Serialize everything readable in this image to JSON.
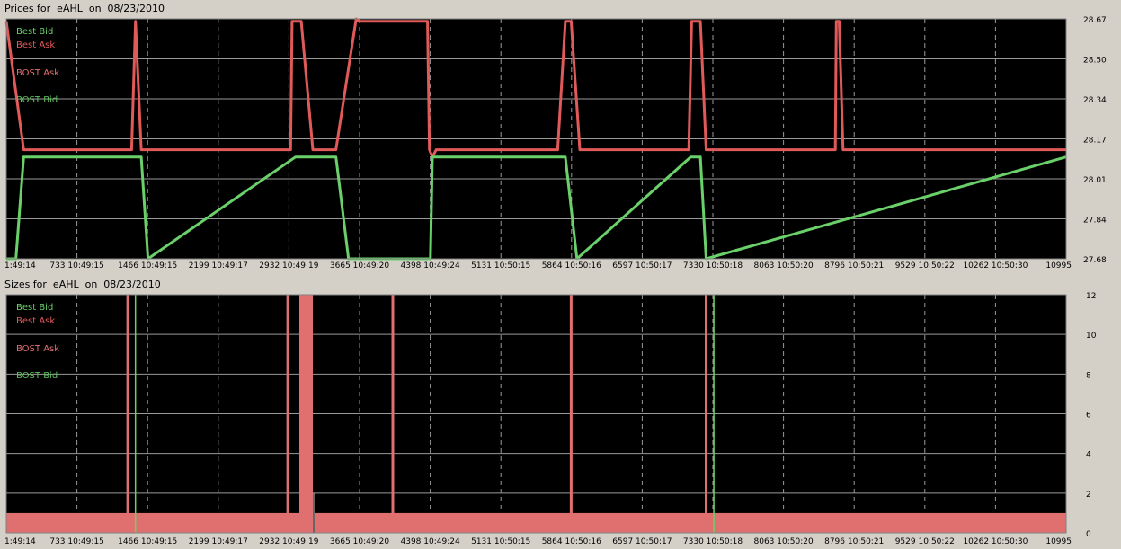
{
  "colors": {
    "plot_bg": "#000000",
    "panel_bg": "#d4d0c8",
    "grid": "#9a9a9a",
    "best_bid": "#6ad06a",
    "best_ask": "#e05a5a",
    "bost_ask": "#e07070",
    "bost_bid": "#5fc05f"
  },
  "chart_data": [
    {
      "type": "line",
      "title": "Prices for  eAHL  on  08/23/2010",
      "x_tick_labels": [
        "1:49:14",
        "733 10:49:15",
        "1466 10:49:15",
        "2199 10:49:17",
        "2932 10:49:19",
        "3665 10:49:20",
        "4398 10:49:24",
        "5131 10:50:15",
        "5864 10:50:16",
        "6597 10:50:17",
        "7330 10:50:18",
        "8063 10:50:20",
        "8796 10:50:21",
        "9529 10:50:22",
        "10262 10:50:30",
        "10995"
      ],
      "xlim": [
        0,
        10995
      ],
      "ylim": [
        27.68,
        28.67
      ],
      "y_tick_labels": [
        "28.67",
        "28.50",
        "28.34",
        "28.17",
        "28.01",
        "27.84",
        "27.68"
      ],
      "legend": [
        "Best Bid",
        "Best Ask",
        "BOST Ask",
        "BOST Bid"
      ],
      "legend_placement": "top-left",
      "grid": true,
      "series": [
        {
          "name": "Best Ask",
          "color_key": "best_ask",
          "x": [
            0,
            180,
            1300,
            1340,
            1400,
            2950,
            2965,
            3030,
            3060,
            3180,
            3420,
            3630,
            3660,
            4370,
            4390,
            4420,
            4460,
            4550,
            4600,
            4700,
            5720,
            5800,
            5860,
            5950,
            7080,
            7110,
            7200,
            7260,
            8600,
            8610,
            8640,
            8680,
            10995
          ],
          "y": [
            28.66,
            28.13,
            28.13,
            28.66,
            28.13,
            28.13,
            28.66,
            28.66,
            28.66,
            28.13,
            28.13,
            28.67,
            28.66,
            28.66,
            28.13,
            28.1,
            28.13,
            28.13,
            28.13,
            28.13,
            28.13,
            28.66,
            28.66,
            28.13,
            28.13,
            28.66,
            28.66,
            28.13,
            28.13,
            28.66,
            28.66,
            28.13,
            28.13
          ]
        },
        {
          "name": "Best Bid",
          "color_key": "best_bid",
          "x": [
            0,
            100,
            180,
            1300,
            1400,
            1470,
            3000,
            3060,
            3180,
            3420,
            3550,
            3580,
            4400,
            4420,
            4460,
            5720,
            5800,
            5920,
            7100,
            7200,
            7260,
            10995
          ],
          "y": [
            27.68,
            27.68,
            28.1,
            28.1,
            28.1,
            27.68,
            28.1,
            28.1,
            28.1,
            28.1,
            27.68,
            27.68,
            27.68,
            28.1,
            28.1,
            28.1,
            28.1,
            27.68,
            28.1,
            28.1,
            27.68,
            28.1
          ]
        }
      ]
    },
    {
      "type": "area",
      "title": "Sizes for  eAHL  on  08/23/2010",
      "x_tick_labels": [
        "1:49:14",
        "733 10:49:15",
        "1466 10:49:15",
        "2199 10:49:17",
        "2932 10:49:19",
        "3665 10:49:20",
        "4398 10:49:24",
        "5131 10:50:15",
        "5864 10:50:16",
        "6597 10:50:17",
        "7330 10:50:18",
        "8063 10:50:20",
        "8796 10:50:21",
        "9529 10:50:22",
        "10262 10:50:30",
        "10995"
      ],
      "xlim": [
        0,
        10995
      ],
      "ylim": [
        0,
        12
      ],
      "y_tick_labels": [
        "12",
        "10",
        "8",
        "6",
        "4",
        "2",
        "0"
      ],
      "legend": [
        "Best Bid",
        "Best Ask",
        "BOST Ask",
        "BOST Bid"
      ],
      "legend_placement": "top-left",
      "grid": true,
      "base_level": 1,
      "ask_spikes": [
        {
          "x": 1260,
          "y": 12
        },
        {
          "x": 2920,
          "y": 12
        },
        {
          "x": 4010,
          "y": 12
        },
        {
          "x": 5860,
          "y": 12
        },
        {
          "x": 7260,
          "y": 12
        }
      ],
      "ask_block": {
        "x0": 3040,
        "x1": 3180,
        "y": 12
      },
      "bid_spikes": [
        {
          "x": 1340,
          "y": 12
        },
        {
          "x": 7340,
          "y": 12
        }
      ],
      "gap": {
        "x": 3180,
        "y": 2
      }
    }
  ]
}
